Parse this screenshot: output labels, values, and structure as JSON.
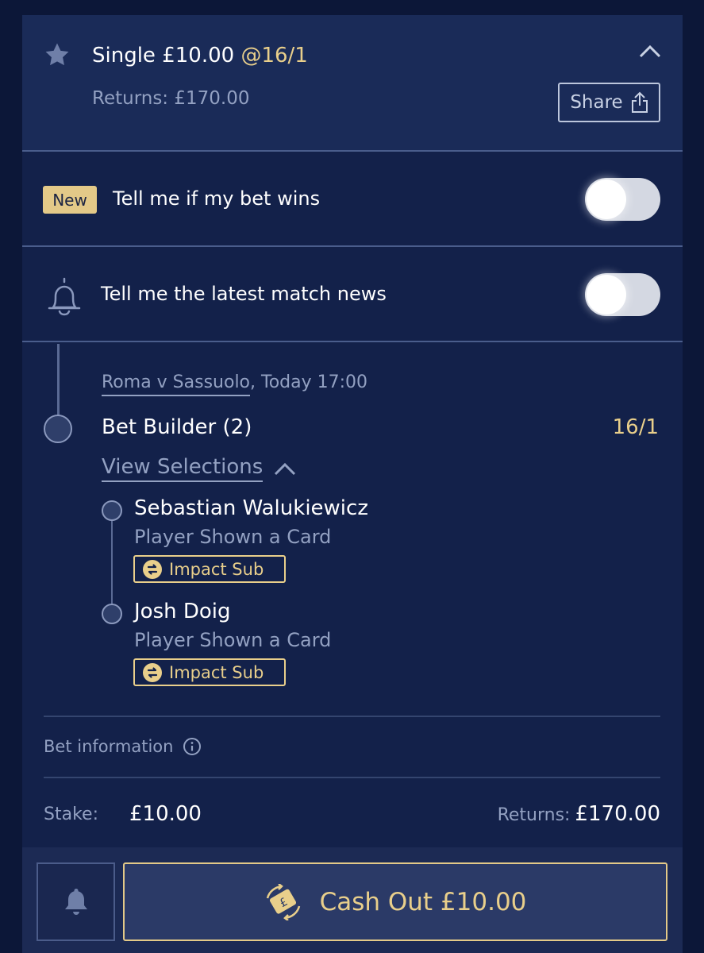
{
  "header": {
    "bet_type": "Single £10.00",
    "odds": "@16/1",
    "returns": "Returns: £170.00",
    "share_label": "Share"
  },
  "notifications": {
    "new_badge": "New",
    "win_label": "Tell me if my bet wins",
    "news_label": "Tell me the latest match news",
    "win_toggle_on": false,
    "news_toggle_on": false
  },
  "event": {
    "match": "Roma v Sassuolo",
    "time": ", Today 17:00",
    "bet_builder": "Bet Builder (2)",
    "odds": "16/1",
    "view_selections": "View Selections",
    "selections": [
      {
        "name": "Sebastian Walukiewicz",
        "market": "Player Shown a Card",
        "tag": "Impact Sub"
      },
      {
        "name": "Josh Doig",
        "market": "Player Shown a Card",
        "tag": "Impact Sub"
      }
    ]
  },
  "info": {
    "bet_information": "Bet information",
    "stake_label": "Stake:",
    "stake_value": "£10.00",
    "returns_label": "Returns:",
    "returns_value": "£170.00"
  },
  "footer": {
    "cash_out_label": "Cash Out £10.00"
  },
  "colors": {
    "background": "#0c1738",
    "card": "#13214a",
    "header": "#1a2b58",
    "gold": "#e9cf8b",
    "muted": "#93a1c2"
  }
}
